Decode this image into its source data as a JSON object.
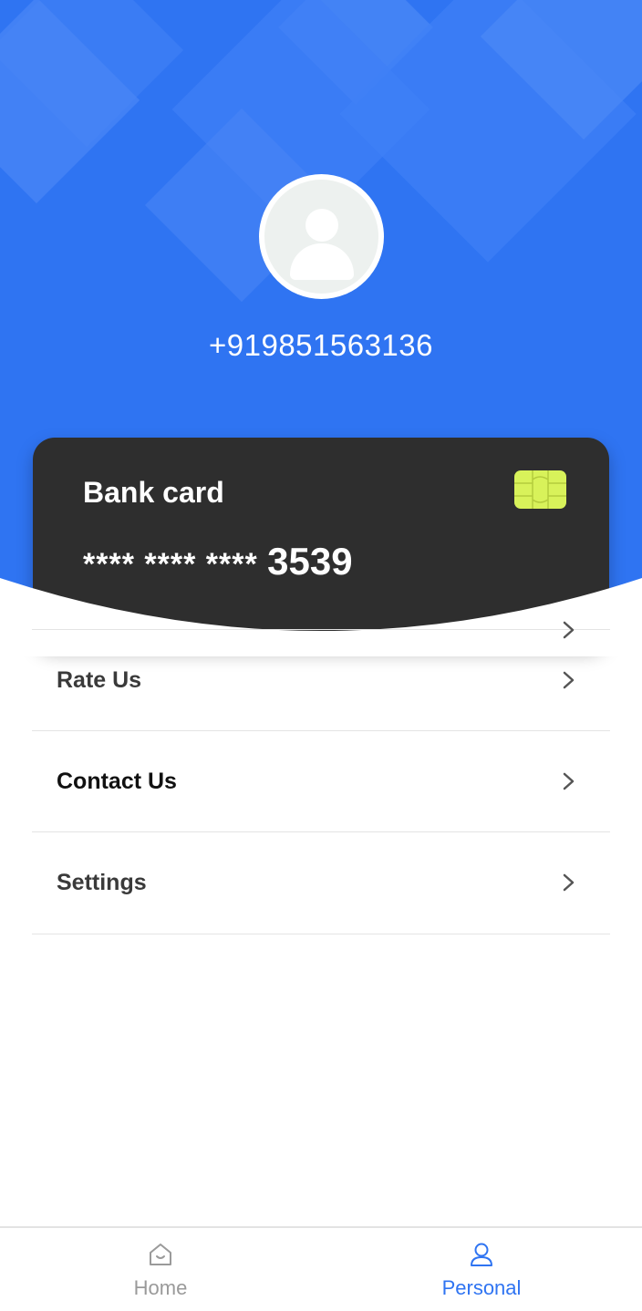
{
  "profile": {
    "phone": "+919851563136"
  },
  "bank_card": {
    "title": "Bank card",
    "masked_digits": "**** **** ****",
    "last_digits": "3539"
  },
  "menu": {
    "items": [
      {
        "label": "Rate Us"
      },
      {
        "label": "Contact Us"
      },
      {
        "label": "Settings"
      }
    ]
  },
  "tabbar": {
    "home_label": "Home",
    "personal_label": "Personal",
    "active_color": "#2f74f2",
    "inactive_color": "#9a9a9a"
  },
  "colors": {
    "header_blue": "#2f74f2",
    "card_bg": "#2e2e2e",
    "chip": "#d8f25a"
  }
}
